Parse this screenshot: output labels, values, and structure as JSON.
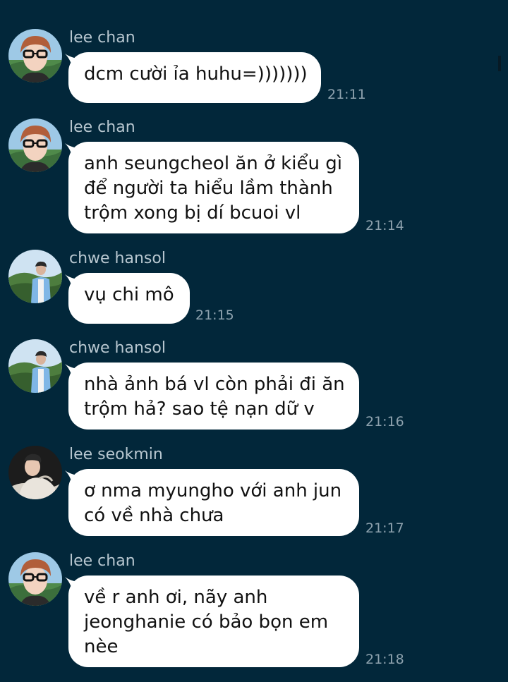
{
  "messages": [
    {
      "sender": "lee chan",
      "avatar_icon": "lee-chan-avatar-icon",
      "lines": [
        "dcm cười ỉa huhu=)))))))"
      ],
      "time": "21:11"
    },
    {
      "sender": "lee chan",
      "avatar_icon": "lee-chan-avatar-icon",
      "lines": [
        "anh seungcheol ăn ở kiểu gì",
        "để người ta hiểu lầm thành",
        "trộm xong bị dí bcuoi vl"
      ],
      "time": "21:14"
    },
    {
      "sender": "chwe hansol",
      "avatar_icon": "chwe-hansol-avatar-icon",
      "lines": [
        "vụ chi mô"
      ],
      "time": "21:15"
    },
    {
      "sender": "chwe hansol",
      "avatar_icon": "chwe-hansol-avatar-icon",
      "lines": [
        "nhà ảnh bá vl còn phải đi ăn",
        "trộm hả? sao tệ nạn dữ v"
      ],
      "time": "21:16"
    },
    {
      "sender": "lee seokmin",
      "avatar_icon": "lee-seokmin-avatar-icon",
      "lines": [
        "ơ nma myungho với anh jun",
        "có về nhà chưa"
      ],
      "time": "21:17"
    },
    {
      "sender": "lee chan",
      "avatar_icon": "lee-chan-avatar-icon",
      "lines": [
        "về r anh ơi, nãy anh",
        "jeonghanie có bảo bọn em",
        "nèe"
      ],
      "time": "21:18"
    }
  ],
  "colors": {
    "background": "#02273a",
    "bubble": "#ffffff",
    "sender_text": "#b8c7d0",
    "timestamp_text": "#8ea2ae"
  }
}
